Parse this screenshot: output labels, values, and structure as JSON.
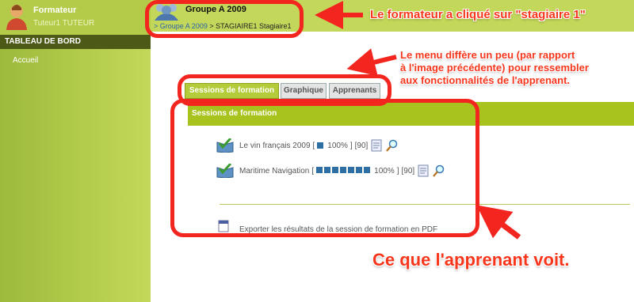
{
  "sidebar": {
    "user_name": "Formateur",
    "user_role": "Tuteur1 TUTEUR",
    "dashboard_title": "TABLEAU DE BORD",
    "menu": [
      {
        "label": "Accueil"
      }
    ]
  },
  "header": {
    "group_title": "Groupe A 2009",
    "breadcrumb": {
      "prefix": ">",
      "link": "Groupe A 2009",
      "separator": ">",
      "current": "STAGIAIRE1 Stagiaire1"
    }
  },
  "tabs": [
    {
      "label": "Sessions de formation",
      "active": true
    },
    {
      "label": "Graphique",
      "active": false
    },
    {
      "label": "Apprenants",
      "active": false
    }
  ],
  "section_title": "Sessions de formation",
  "sessions": [
    {
      "title": "Le vin français 2009",
      "open": "[",
      "progress_percent": 100,
      "progress_text": "100%",
      "close": "]",
      "score": "[90]",
      "segments": 1
    },
    {
      "title": "Maritime Navigation",
      "open": "[",
      "progress_percent": 100,
      "progress_text": "100%",
      "close": "]",
      "score": "[90]",
      "segments": 7
    }
  ],
  "export_label": "Exporter les résultats de la session de formation en PDF",
  "annotations": {
    "note_1": "Le formateur a cliqué sur \"stagiaire 1\"",
    "note_2_lines": [
      "Le menu diffère un peu (par rapport",
      "à l'image précédente) pour ressembler",
      "aux fonctionnalités de l'apprenant."
    ],
    "note_3": "Ce que l'apprenant voit."
  },
  "colors": {
    "accent_green": "#a8c21e",
    "sidebar_dark": "#4d5a17",
    "annotation_red": "#f2261f",
    "progress_blue": "#2f6ea3"
  }
}
